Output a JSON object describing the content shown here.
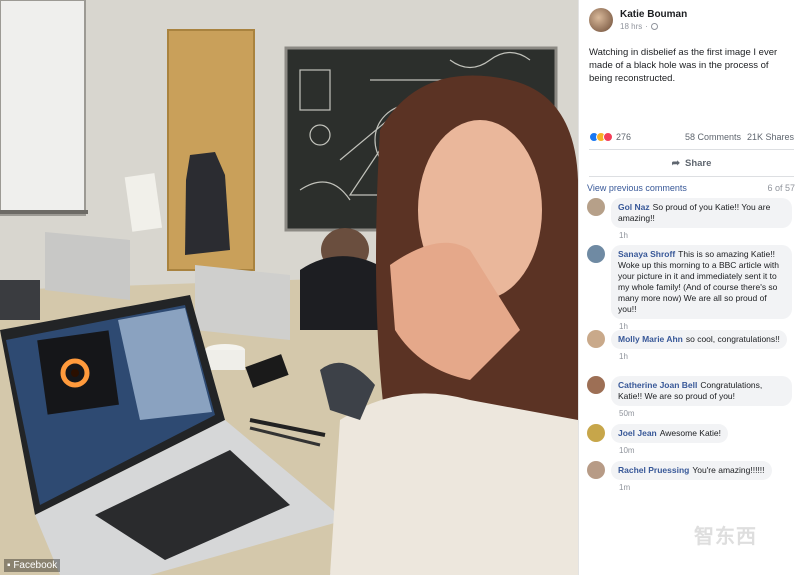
{
  "photo": {
    "credit": "Facebook"
  },
  "post": {
    "author": "Katie Bouman",
    "time": "18 hrs",
    "text": "Watching in disbelief as the first image I ever made of a black hole was in the process of being reconstructed.",
    "reaction_count": "276",
    "comments_count": "58 Comments",
    "shares_count": "21K Shares",
    "share_label": "Share"
  },
  "comments_section": {
    "view_previous": "View previous comments",
    "paging": "6 of 57",
    "items": [
      {
        "name": "Gol Naz",
        "text": "So proud of you Katie!! You are amazing!!",
        "time": "1h"
      },
      {
        "name": "Sanaya Shroff",
        "text": "This is so amazing Katie!! Woke up this morning to a BBC article with your picture in it and immediately sent it to my whole family! (And of course there's so many more now) We are all so proud of you!!",
        "time": "1h"
      },
      {
        "name": "Molly Marie Ahn",
        "text": "so cool, congratulations!!",
        "time": "1h"
      },
      {
        "name": "Catherine Joan Bell",
        "text": "Congratulations, Katie!! We are so proud of you!",
        "time": "50m"
      },
      {
        "name": "Joel Jean",
        "text": "Awesome Katie!",
        "time": "10m"
      },
      {
        "name": "Rachel Pruessing",
        "text": "You're amazing!!!!!!",
        "time": "1m"
      }
    ]
  },
  "watermark": "智东西",
  "colors": {
    "link": "#385898",
    "like": "#1877f2",
    "bubble": "#f2f3f5"
  }
}
